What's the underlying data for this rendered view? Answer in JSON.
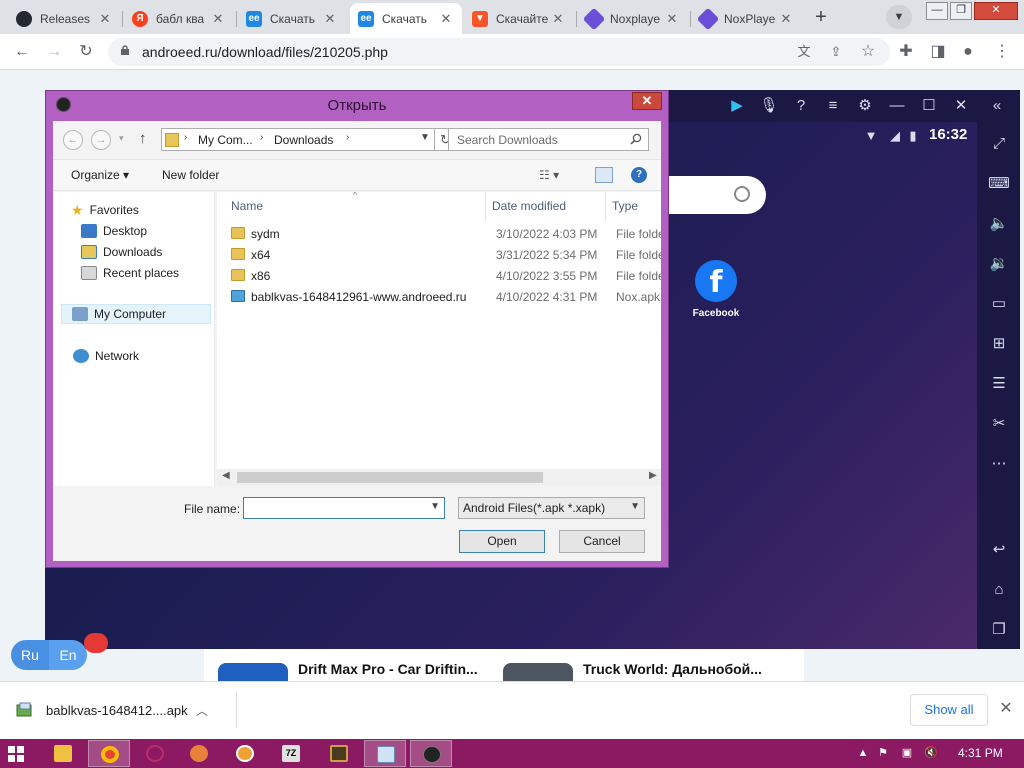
{
  "browser": {
    "tabs": [
      {
        "title": "Releases",
        "favicon_color": "#24292f",
        "favicon_glyph": "github-icon"
      },
      {
        "title": "бабл ква",
        "favicon_color": "#fc3f1d",
        "favicon_glyph": "yandex-icon"
      },
      {
        "title": "Скачать",
        "favicon_color": "#1e88e5",
        "favicon_glyph": "androeed-icon"
      },
      {
        "title": "Скачать",
        "favicon_color": "#1e88e5",
        "favicon_glyph": "androeed-icon"
      },
      {
        "title": "Скачайте",
        "favicon_color": "#fb542b",
        "favicon_glyph": "brave-icon"
      },
      {
        "title": "Noxplaye",
        "favicon_color": "#6b4fd8",
        "favicon_glyph": "nox-icon"
      },
      {
        "title": "NoxPlaye",
        "favicon_color": "#6b4fd8",
        "favicon_glyph": "nox-icon"
      }
    ],
    "url": "androeed.ru/download/files/210205.php"
  },
  "nox": {
    "time": "16:32",
    "app_label": "Facebook"
  },
  "page": {
    "lang_ru": "Ru",
    "lang_en": "En",
    "apps": [
      {
        "name": "Drift Max Pro - Car Driftin...",
        "thumb_color": "#1f5fbf"
      },
      {
        "name": "Truck World: Дальнобой...",
        "thumb_color": "#4d5560"
      }
    ]
  },
  "downloads": {
    "file": "bablkvas-1648412....apk",
    "show_all": "Show all"
  },
  "taskbar": {
    "time": "4:31 PM"
  },
  "dialog": {
    "title": "Открыть",
    "breadcrumb": [
      "My Com...",
      "Downloads"
    ],
    "search_placeholder": "Search Downloads",
    "organize": "Organize",
    "new_folder": "New folder",
    "nav": {
      "favorites": "Favorites",
      "desktop": "Desktop",
      "downloads": "Downloads",
      "recent": "Recent places",
      "my_computer": "My Computer",
      "network": "Network"
    },
    "columns": {
      "name": "Name",
      "date": "Date modified",
      "type": "Type"
    },
    "files": [
      {
        "name": "sydm",
        "date": "3/10/2022 4:03 PM",
        "type": "File folder",
        "kind": "folder"
      },
      {
        "name": "x64",
        "date": "3/31/2022 5:34 PM",
        "type": "File folder",
        "kind": "folder"
      },
      {
        "name": "x86",
        "date": "4/10/2022 3:55 PM",
        "type": "File folder",
        "kind": "folder"
      },
      {
        "name": "bablkvas-1648412961-www.androeed.ru",
        "date": "4/10/2022 4:31 PM",
        "type": "Nox.apk",
        "kind": "apk"
      }
    ],
    "file_name_label": "File name:",
    "file_name_value": "",
    "filter": "Android Files(*.apk *.xapk)",
    "open": "Open",
    "cancel": "Cancel"
  }
}
